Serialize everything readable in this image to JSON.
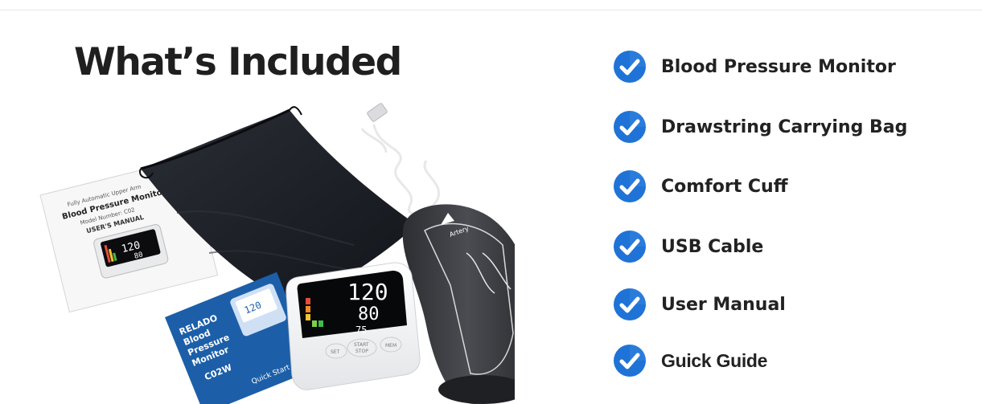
{
  "heading": "What’s Included",
  "colors": {
    "check_blue": "#1f73d6",
    "check_blue_dark": "#0d4fa3",
    "text": "#222222",
    "bag": "#1c1f24",
    "cuff": "#3a3c40",
    "monitor": "#f4f5f6",
    "guide_blue": "#1c5fa8"
  },
  "items": [
    {
      "icon": "check-circle-icon",
      "label": "Blood Pressure Monitor"
    },
    {
      "icon": "check-circle-icon",
      "label": "Drawstring Carrying Bag"
    },
    {
      "icon": "check-circle-icon",
      "label": "Comfort Cuff"
    },
    {
      "icon": "check-circle-icon",
      "label": "USB Cable"
    },
    {
      "icon": "check-circle-icon",
      "label": "User Manual"
    },
    {
      "icon": "check-circle-icon",
      "label": "Guick Guide"
    }
  ],
  "manual": {
    "line1": "Fully Automatic Upper Arm",
    "line2": "Blood Pressure Monitor",
    "line3": "Model Number: C02",
    "line4": "USER'S MANUAL"
  },
  "quick_guide": {
    "brand": "RELADO",
    "line1": "Blood",
    "line2": "Pressure",
    "line3": "Monitor",
    "model": "C02W",
    "footer": "Quick Start Guide"
  },
  "monitor": {
    "systolic": "120",
    "diastolic": "80",
    "pulse": "75",
    "btn_set": "SET",
    "btn_start": "START",
    "btn_stop": "STOP",
    "btn_mem": "MEM"
  },
  "cuff_label": "Artery"
}
